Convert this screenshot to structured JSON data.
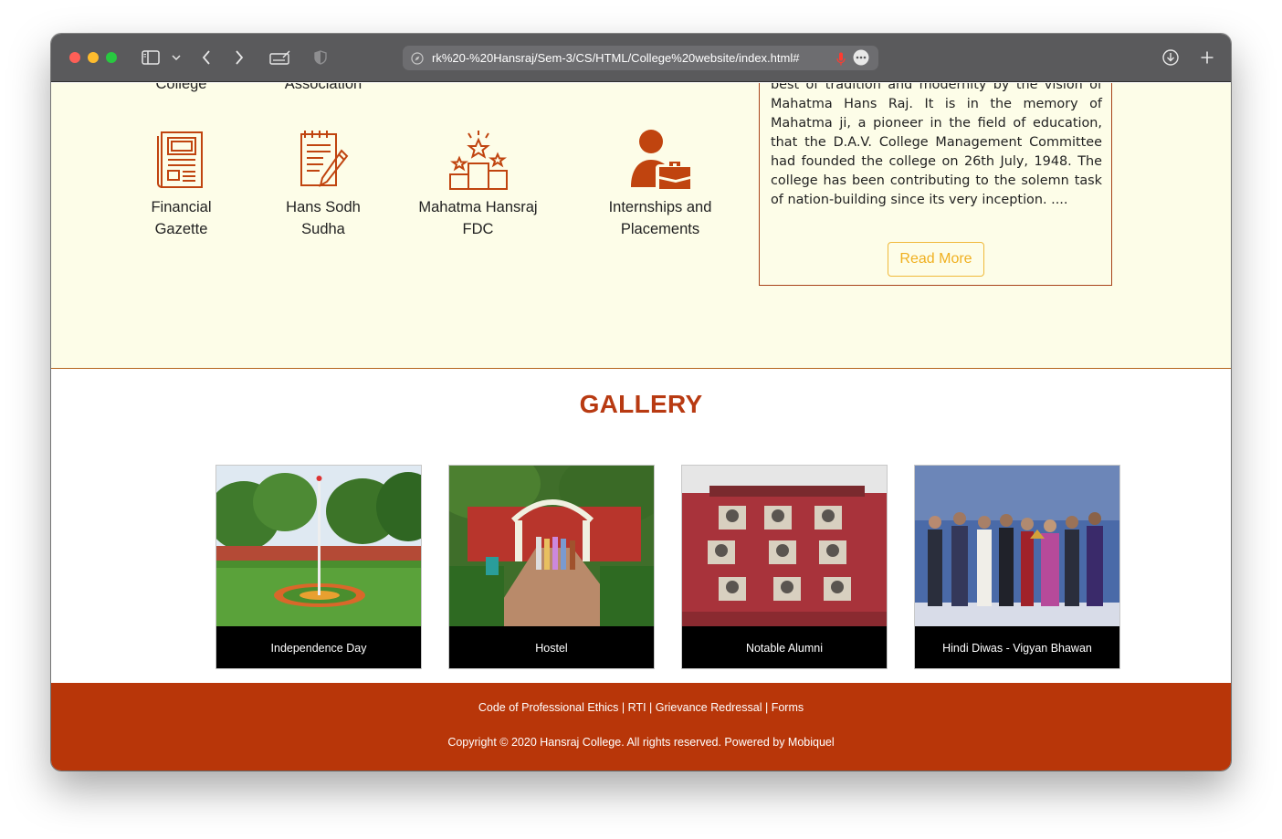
{
  "browser": {
    "url": "rk%20-%20Hansraj/Sem-3/CS/HTML/College%20website/index.html#"
  },
  "quick_links": {
    "top_row_partial": [
      "College",
      "Association"
    ],
    "items": [
      {
        "label_line1": "Financial",
        "label_line2": "Gazette",
        "icon": "newspaper-icon"
      },
      {
        "label_line1": "Hans Sodh",
        "label_line2": "Sudha",
        "icon": "notepad-pencil-icon"
      },
      {
        "label_line1": "Mahatma Hansraj",
        "label_line2": "FDC",
        "icon": "podium-stars-icon"
      },
      {
        "label_line1": "Internships and",
        "label_line2": "Placements",
        "icon": "person-briefcase-icon"
      }
    ],
    "icon_color": "#c0440f"
  },
  "about": {
    "text": "college is guided in its mission of combining the best of tradition and modernity by the vision of Mahatma Hans Raj. It is in the memory of Mahatma ji, a pioneer in the field of education, that the D.A.V. College Management Committee had founded the college on 26th July, 1948. The college has been contributing to the solemn task of nation-building since its very inception. ....",
    "read_more_label": "Read More"
  },
  "gallery": {
    "title": "GALLERY",
    "items": [
      {
        "caption": "Independence Day"
      },
      {
        "caption": "Hostel"
      },
      {
        "caption": "Notable Alumni"
      },
      {
        "caption": "Hindi Diwas - Vigyan Bhawan"
      }
    ]
  },
  "footer": {
    "links": [
      "Code of Professional Ethics",
      "RTI",
      "Grievance Redressal",
      "Forms"
    ],
    "separator": " | ",
    "copyright": "Copyright © 2020 Hansraj College. All rights reserved. Powered by Mobiquel"
  },
  "colors": {
    "accent": "#b83a12",
    "cream": "#fdfde8",
    "footer": "#b83609",
    "read_more": "#f0b020"
  }
}
